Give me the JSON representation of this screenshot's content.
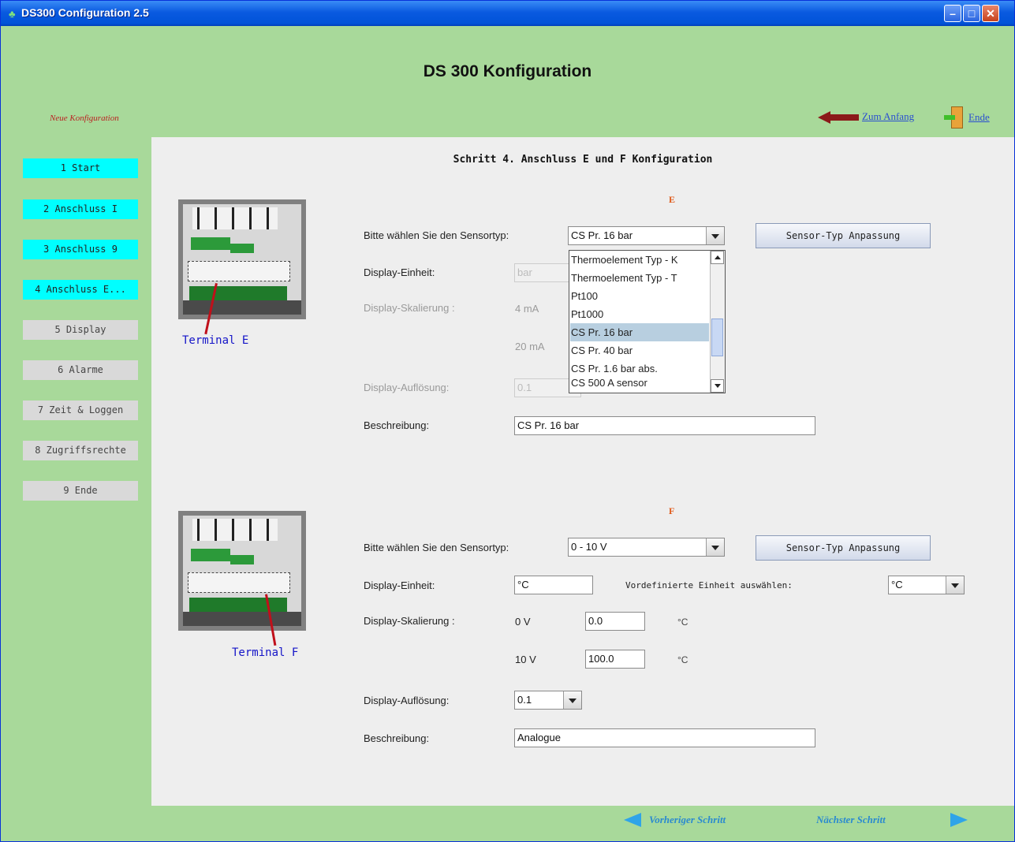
{
  "window": {
    "title": "DS300 Configuration 2.5"
  },
  "header": {
    "title": "DS 300 Konfiguration",
    "new_config_label": "Neue Konfiguration",
    "zum_anfang": "Zum Anfang",
    "ende": "Ende"
  },
  "sidebar": {
    "items": [
      {
        "label": "1 Start",
        "state": "done"
      },
      {
        "label": "2 Anschluss I",
        "state": "done"
      },
      {
        "label": "3 Anschluss 9",
        "state": "done"
      },
      {
        "label": "4 Anschluss E...",
        "state": "current"
      },
      {
        "label": "5 Display",
        "state": "todo"
      },
      {
        "label": "6 Alarme",
        "state": "todo"
      },
      {
        "label": "7 Zeit & Loggen",
        "state": "todo"
      },
      {
        "label": "8 Zugriffsrechte",
        "state": "todo"
      },
      {
        "label": "9 Ende",
        "state": "todo"
      }
    ]
  },
  "content": {
    "step_title": "Schritt 4. Anschluss E und F Konfiguration",
    "section_e": {
      "letter": "E",
      "terminal_label": "Terminal E",
      "sensor_label": "Bitte wählen Sie den Sensortyp:",
      "sensor_value": "CS Pr. 16 bar",
      "sensor_button": "Sensor-Typ Anpassung",
      "display_unit_label": "Display-Einheit:",
      "display_unit_value": "bar",
      "scaling_label": "Display-Skalierung :",
      "scale_low_label": "4 mA",
      "scale_high_label": "20 mA",
      "resolution_label": "Display-Auflösung:",
      "resolution_value": "0.1",
      "description_label": "Beschreibung:",
      "description_value": "CS Pr. 16 bar",
      "dropdown_options": [
        "Thermoelement Typ - K",
        "Thermoelement Typ - T",
        "Pt100",
        "Pt1000",
        "CS Pr. 16 bar",
        "CS Pr. 40 bar",
        "CS Pr. 1.6 bar abs.",
        "CS 500 A sensor"
      ],
      "dropdown_selected": "CS Pr. 16 bar"
    },
    "section_f": {
      "letter": "F",
      "terminal_label": "Terminal F",
      "sensor_label": "Bitte wählen Sie den Sensortyp:",
      "sensor_value": "0 - 10 V",
      "sensor_button": "Sensor-Typ Anpassung",
      "display_unit_label": "Display-Einheit:",
      "display_unit_value": "°C",
      "predefined_unit_label": "Vordefinierte Einheit auswählen:",
      "predefined_unit_value": "°C",
      "scaling_label": "Display-Skalierung :",
      "scale_low_label": "0 V",
      "scale_low_value": "0.0",
      "scale_high_label": "10 V",
      "scale_high_value": "100.0",
      "scale_unit": "°C",
      "resolution_label": "Display-Auflösung:",
      "resolution_value": "0.1",
      "description_label": "Beschreibung:",
      "description_value": "Analogue"
    }
  },
  "footer": {
    "prev_label": "Vorheriger Schritt",
    "next_label": "Nächster Schritt"
  },
  "colors": {
    "background": "#a8d99a",
    "active_step": "#00ffff",
    "inactive_step": "#d9d9d9",
    "section_letter": "#e05a1a",
    "terminal_label": "#1414c8"
  }
}
